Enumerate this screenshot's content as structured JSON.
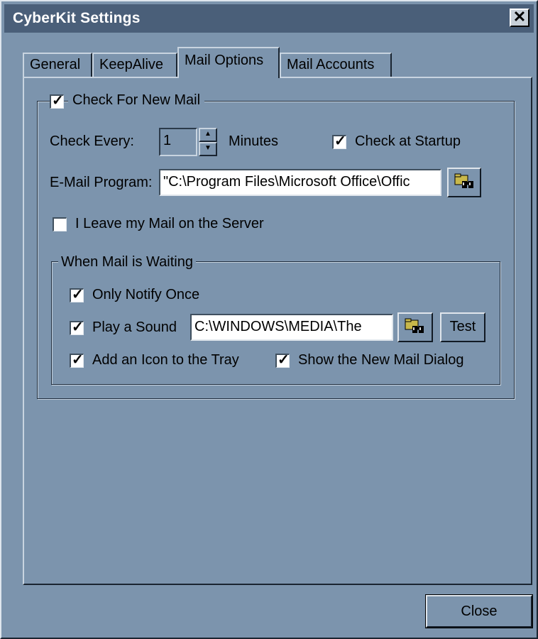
{
  "window": {
    "title": "CyberKit Settings",
    "close_glyph": "✕"
  },
  "tabs": [
    {
      "label": "General"
    },
    {
      "label": "KeepAlive"
    },
    {
      "label": "Mail Options",
      "active": true
    },
    {
      "label": "Mail Accounts"
    }
  ],
  "check_new_mail": {
    "label": "Check For New Mail",
    "checked": true
  },
  "check_every": {
    "label": "Check Every:",
    "value": "1",
    "unit": "Minutes"
  },
  "check_at_startup": {
    "label": "Check at Startup",
    "checked": true
  },
  "email_program": {
    "label": "E-Mail Program:",
    "value": "\"C:\\Program Files\\Microsoft Office\\Offic"
  },
  "leave_mail": {
    "label": "I Leave my Mail on the Server",
    "checked": false
  },
  "when_waiting": {
    "legend": "When Mail is Waiting",
    "only_notify_once": {
      "label": "Only Notify Once",
      "checked": true
    },
    "play_sound": {
      "label": "Play a Sound",
      "checked": true,
      "path": "C:\\WINDOWS\\MEDIA\\The"
    },
    "test_label": "Test",
    "add_icon": {
      "label": "Add an Icon to the Tray",
      "checked": true
    },
    "show_dialog": {
      "label": "Show the New Mail Dialog",
      "checked": true
    }
  },
  "footer": {
    "close_label": "Close"
  },
  "icons": {
    "browse": "folder-binoculars-icon",
    "check": "checkmark-icon"
  },
  "colors": {
    "face": "#7c94ad",
    "titlebar": "#4a5f79",
    "title_text": "#ffffff"
  }
}
